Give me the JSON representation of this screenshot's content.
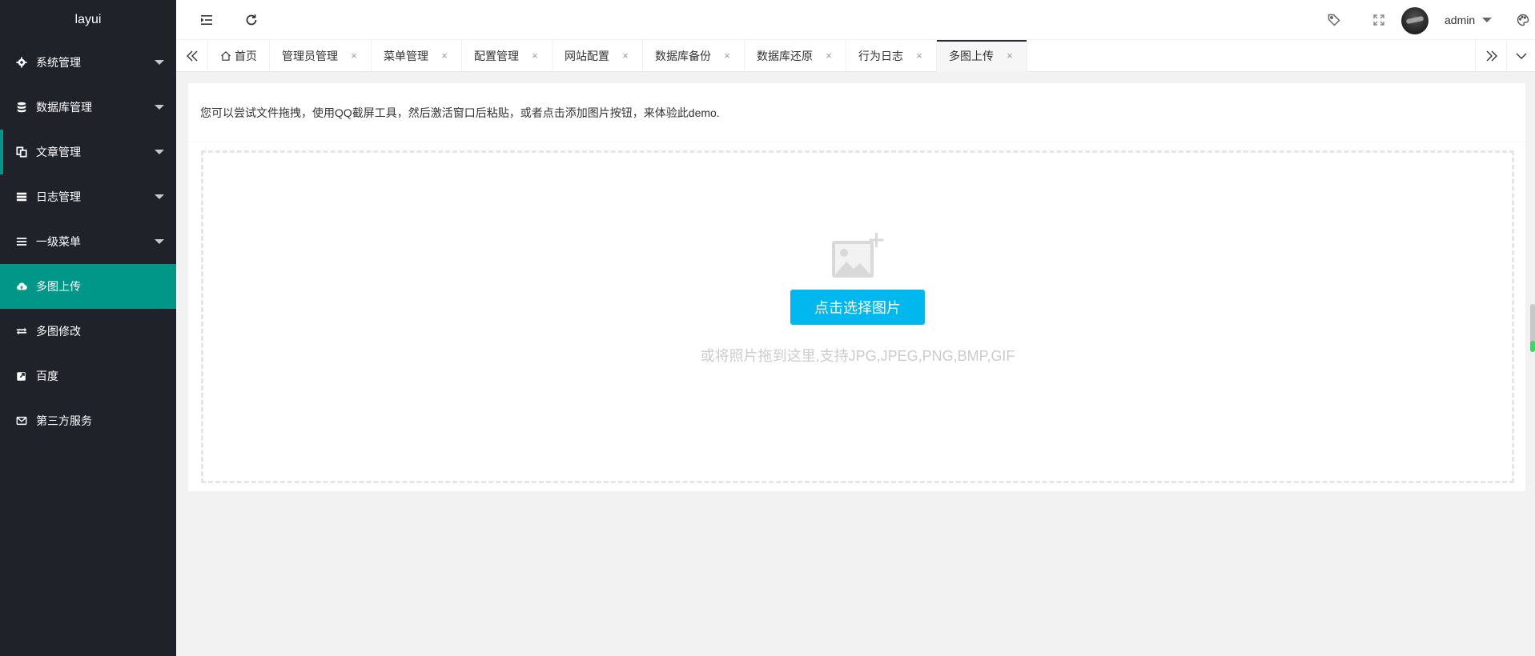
{
  "sidebar": {
    "logo": "layui",
    "items": [
      {
        "label": "系统管理",
        "icon": "gear-icon",
        "has_children": true
      },
      {
        "label": "数据库管理",
        "icon": "database-icon",
        "has_children": true
      },
      {
        "label": "文章管理",
        "icon": "copy-icon",
        "has_children": true
      },
      {
        "label": "日志管理",
        "icon": "server-icon",
        "has_children": true
      },
      {
        "label": "一级菜单",
        "icon": "menu-icon",
        "has_children": true
      },
      {
        "label": "多图上传",
        "icon": "cloud-upload-icon",
        "has_children": false
      },
      {
        "label": "多图修改",
        "icon": "exchange-icon",
        "has_children": false
      },
      {
        "label": "百度",
        "icon": "external-link-icon",
        "has_children": false
      },
      {
        "label": "第三方服务",
        "icon": "envelope-icon",
        "has_children": false
      }
    ]
  },
  "header": {
    "username": "admin"
  },
  "tabs": [
    {
      "label": "首页",
      "closable": false
    },
    {
      "label": "管理员管理",
      "closable": true
    },
    {
      "label": "菜单管理",
      "closable": true
    },
    {
      "label": "配置管理",
      "closable": true
    },
    {
      "label": "网站配置",
      "closable": true
    },
    {
      "label": "数据库备份",
      "closable": true
    },
    {
      "label": "数据库还原",
      "closable": true
    },
    {
      "label": "行为日志",
      "closable": true
    },
    {
      "label": "多图上传",
      "closable": true,
      "active": true
    }
  ],
  "tab_close_glyph": "×",
  "content": {
    "description": "您可以尝试文件拖拽，使用QQ截屏工具，然后激活窗口后粘贴，或者点击添加图片按钮，来体验此demo.",
    "pick_button": "点击选择图片",
    "hint": "或将照片拖到这里,支持JPG,JPEG,PNG,BMP,GIF"
  },
  "colors": {
    "sidebar_bg": "#20222a",
    "accent": "#009688",
    "upload_button": "#00b7ee"
  }
}
